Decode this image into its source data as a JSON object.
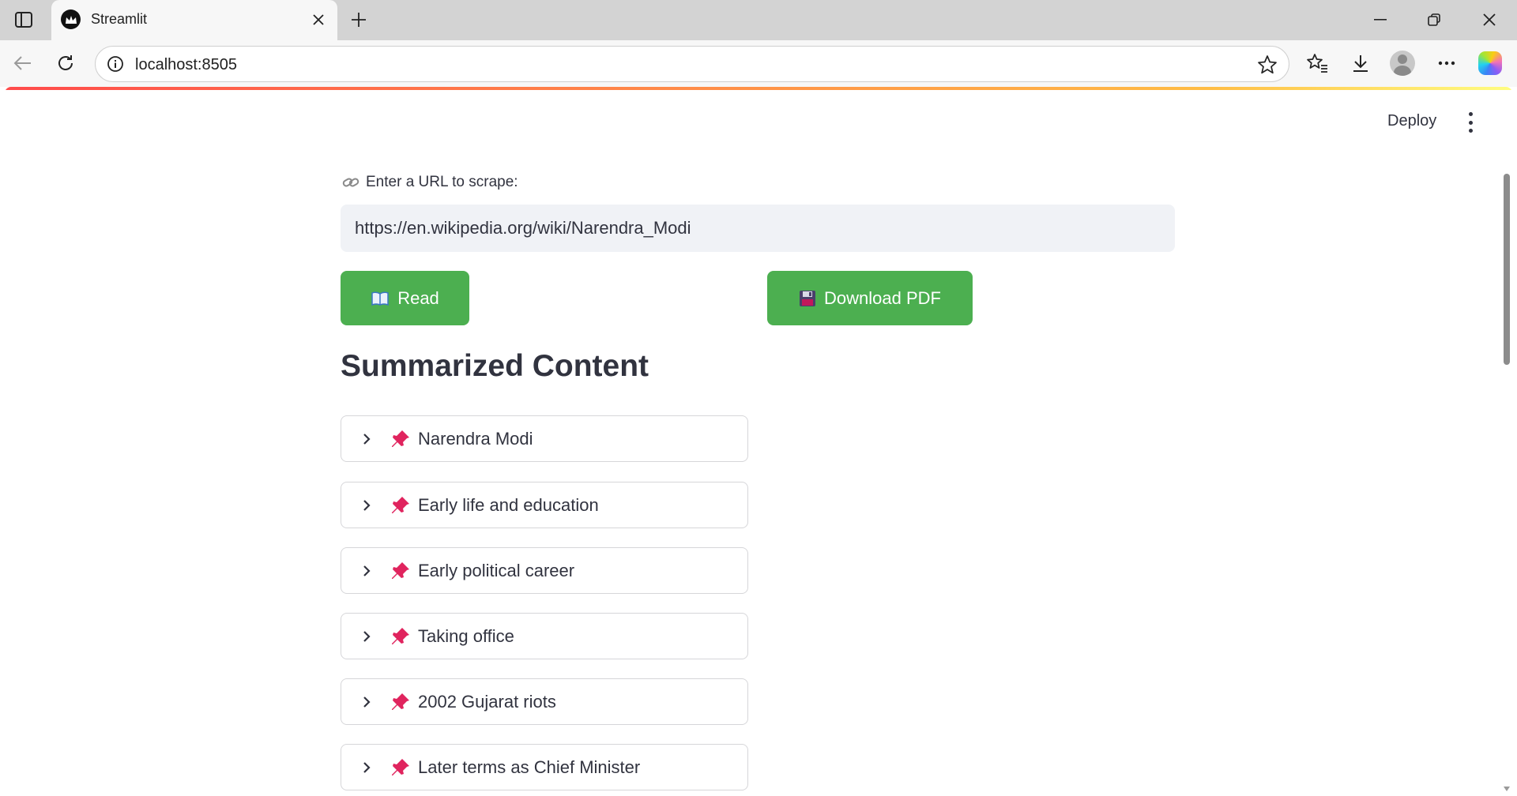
{
  "browser": {
    "tab": {
      "title": "Streamlit"
    },
    "address": {
      "url": "localhost:8505"
    }
  },
  "app": {
    "header": {
      "deploy_label": "Deploy"
    },
    "url_label": "Enter a URL to scrape:",
    "url_value": "https://en.wikipedia.org/wiki/Narendra_Modi",
    "buttons": {
      "read_label": "Read",
      "download_label": "Download PDF"
    },
    "section_title": "Summarized Content",
    "sections": [
      {
        "label": "Narendra Modi"
      },
      {
        "label": "Early life and education"
      },
      {
        "label": "Early political career"
      },
      {
        "label": "Taking office"
      },
      {
        "label": "2002 Gujarat riots"
      },
      {
        "label": "Later terms as Chief Minister"
      }
    ]
  },
  "colors": {
    "primary_button": "#4caf50",
    "text": "#31333f",
    "input_bg": "#f0f2f6",
    "pin": "#e0245e"
  }
}
